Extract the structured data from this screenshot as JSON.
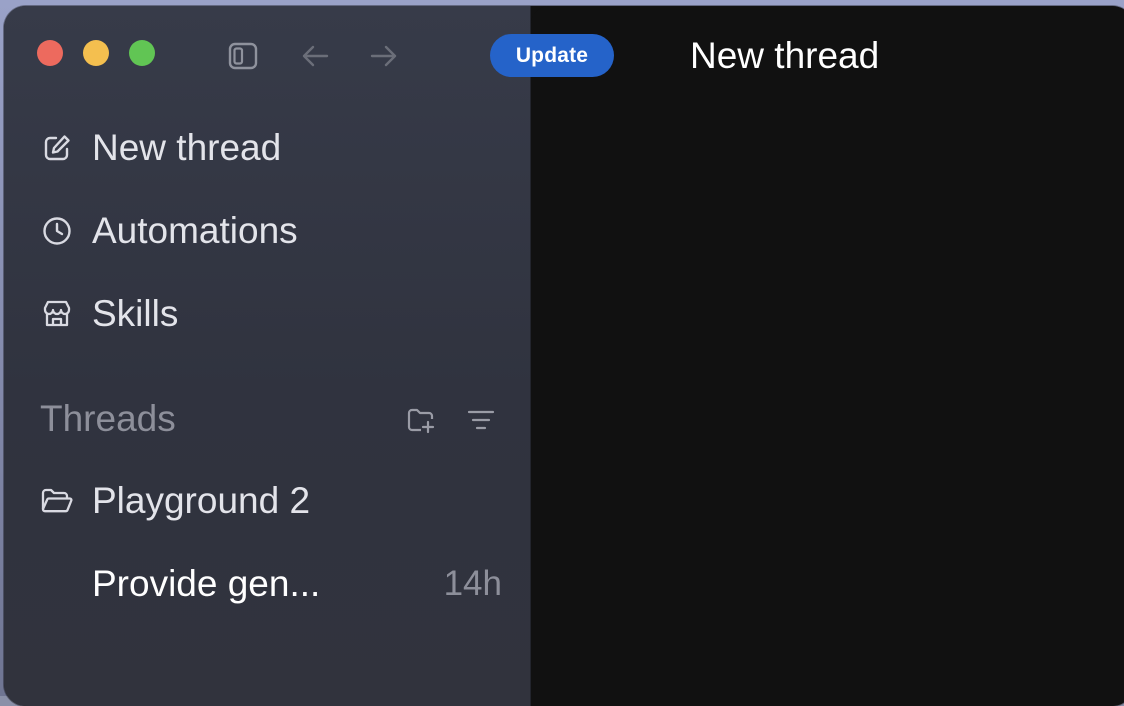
{
  "window": {
    "title": "New thread"
  },
  "toolbar": {
    "update_label": "Update",
    "icons": [
      "sidebar-toggle-icon",
      "arrow-left-icon",
      "arrow-right-icon"
    ]
  },
  "sidebar": {
    "nav": [
      {
        "label": "New thread",
        "icon": "edit-icon"
      },
      {
        "label": "Automations",
        "icon": "clock-icon"
      },
      {
        "label": "Skills",
        "icon": "store-icon"
      }
    ],
    "threads_section": {
      "title": "Threads",
      "icons": [
        "new-folder-icon",
        "filter-icon"
      ]
    },
    "projects": [
      {
        "label": "Playground 2",
        "icon": "folder-open-icon",
        "threads": [
          {
            "title": "Provide gen...",
            "time": "14h"
          }
        ]
      }
    ]
  },
  "colors": {
    "accent": "#2563c9",
    "traffic_red": "#ed6a5e",
    "traffic_yellow": "#f4bf4f",
    "traffic_green": "#61c554"
  }
}
